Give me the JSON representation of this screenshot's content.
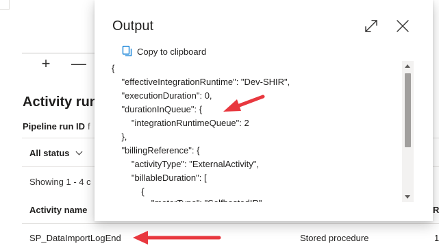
{
  "background": {
    "toolbar": {
      "add_symbol": "+",
      "remove_symbol": "—"
    },
    "section_title": "Activity run",
    "pipeline_run_id_label": "Pipeline run ID",
    "pipeline_run_id_sep": "f",
    "status_filter": "All status",
    "showing_text": "Showing 1 - 4 c",
    "table": {
      "col_activity_name": "Activity name",
      "col_right_partial": "R",
      "row": {
        "name": "SP_DataImportLogEnd",
        "type": "Stored procedure",
        "right_partial": "1"
      }
    }
  },
  "modal": {
    "title": "Output",
    "copy_label": "Copy to clipboard",
    "icons": [
      "expand-icon",
      "close-icon",
      "copy-icon"
    ],
    "code_lines": [
      "{",
      "    \"effectiveIntegrationRuntime\": \"Dev-SHIR\",",
      "    \"executionDuration\": 0,",
      "    \"durationInQueue\": {",
      "        \"integrationRuntimeQueue\": 2",
      "    },",
      "    \"billingReference\": {",
      "        \"activityType\": \"ExternalActivity\",",
      "        \"billableDuration\": [",
      "            {",
      "                \"meterType\": \"SelfhostedIR\","
    ]
  },
  "colors": {
    "arrow": "#e8383f",
    "scroll_thumb": "#a19f9d",
    "text": "#201f1e"
  }
}
